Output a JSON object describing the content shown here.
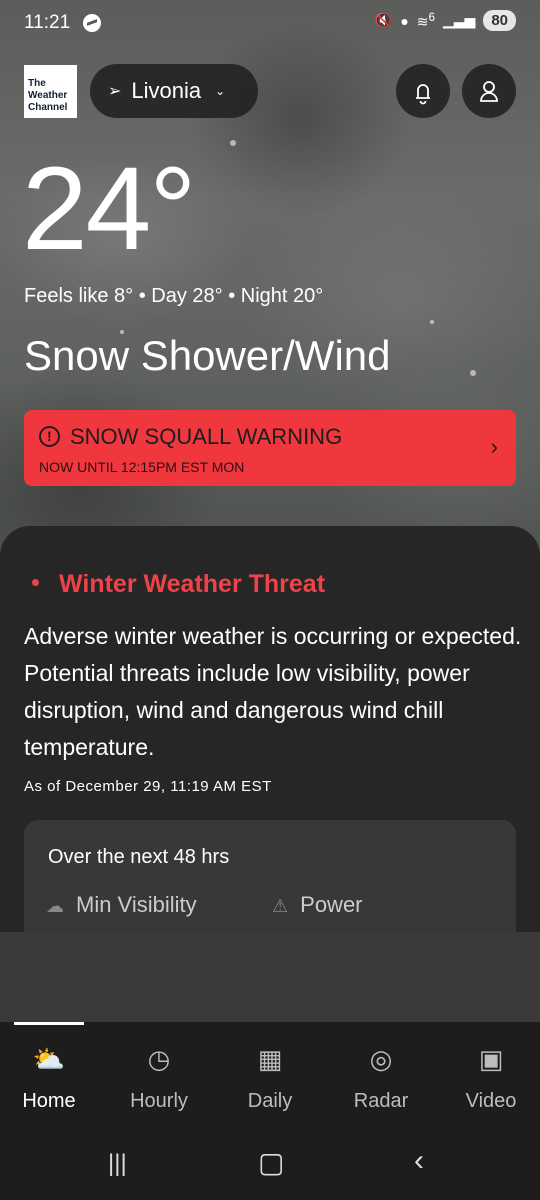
{
  "status_bar": {
    "time": "11:21",
    "signal": "6",
    "battery": "80"
  },
  "header": {
    "logo_text": "The Weather Channel",
    "location": "Livonia"
  },
  "current": {
    "temperature": "24°",
    "feels_line": "Feels like 8° • Day 28° • Night 20°",
    "condition": "Snow Shower/Wind"
  },
  "alert": {
    "title": "SNOW SQUALL WARNING",
    "subtitle": "NOW UNTIL 12:15PM EST MON",
    "color": "#f0373e"
  },
  "threat_card": {
    "title": "Winter Weather Threat",
    "description": "Adverse winter weather is occurring or expected. Potential threats include low visibility, power disruption, wind and dangerous wind chill temperature.",
    "as_of": "As of December 29, 11:19 AM EST",
    "outlook_header": "Over the next 48 hrs",
    "metrics": [
      {
        "label": "Min Visibility",
        "icon": "cloud-icon"
      },
      {
        "label": "Power",
        "icon": "warning-triangle-icon"
      }
    ]
  },
  "tabs": [
    {
      "label": "Home",
      "icon": "home-weather-icon",
      "active": true
    },
    {
      "label": "Hourly",
      "icon": "clock-icon",
      "active": false
    },
    {
      "label": "Daily",
      "icon": "calendar-icon",
      "active": false
    },
    {
      "label": "Radar",
      "icon": "radar-icon",
      "active": false
    },
    {
      "label": "Video",
      "icon": "video-icon",
      "active": false
    }
  ]
}
